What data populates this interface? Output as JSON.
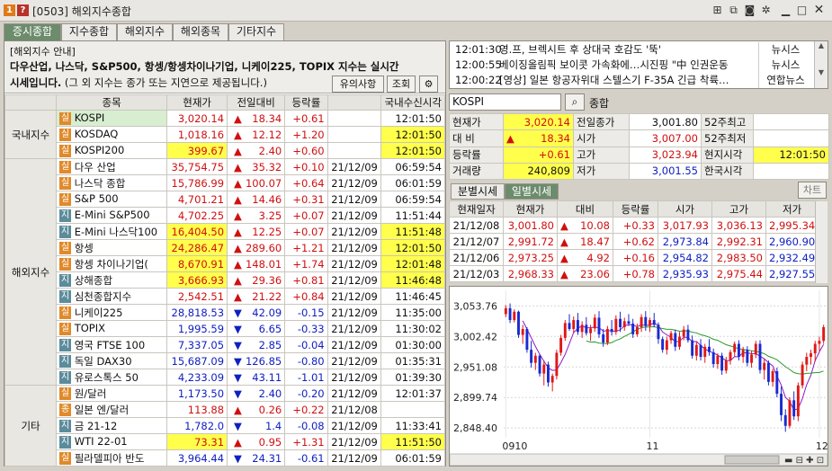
{
  "window": {
    "screen_no": "[0503]",
    "title": "해외지수종합",
    "num1": "1",
    "num2": "?"
  },
  "tabs": [
    {
      "label": "증시종합",
      "active": true
    },
    {
      "label": "지수종합",
      "active": false
    },
    {
      "label": "해외지수",
      "active": false
    },
    {
      "label": "해외종목",
      "active": false
    },
    {
      "label": "기타지수",
      "active": false
    }
  ],
  "notice": {
    "line1": "[해외지수 안내]",
    "line2": "다우산업, 나스닥, S&P500, 항셍/항셍차이나기업, 니케이225, TOPIX 지수는 실시간",
    "line3_bold": "시세입니다.",
    "line3_rest": " (그 외 지수는 종가 또는 지연으로 제공됩니다.)",
    "btn_caution": "유의사항",
    "btn_query": "조회"
  },
  "grid": {
    "headers": [
      "종목",
      "현재가",
      "전일대비",
      "등락률",
      "",
      "국내수신시각"
    ],
    "groups": [
      {
        "label": "국내지수",
        "rows": [
          {
            "badge": "실",
            "name": "KOSPI",
            "price": "3,020.14",
            "arrow": "▲",
            "chg": "18.34",
            "rate": "+0.61",
            "date": "",
            "time": "12:01:50",
            "dir": "up",
            "name_bg": "green",
            "price_bg": "",
            "time_bg": ""
          },
          {
            "badge": "실",
            "name": "KOSDAQ",
            "price": "1,018.16",
            "arrow": "▲",
            "chg": "12.12",
            "rate": "+1.20",
            "date": "",
            "time": "12:01:50",
            "dir": "up",
            "name_bg": "",
            "price_bg": "",
            "time_bg": "yellow"
          },
          {
            "badge": "실",
            "name": "KOSPI200",
            "price": "399.67",
            "arrow": "▲",
            "chg": "2.40",
            "rate": "+0.60",
            "date": "",
            "time": "12:01:50",
            "dir": "up",
            "name_bg": "",
            "price_bg": "yellow",
            "time_bg": "yellow"
          }
        ]
      },
      {
        "label": "해외지수",
        "rows": [
          {
            "badge": "실",
            "name": "다우 산업",
            "price": "35,754.75",
            "arrow": "▲",
            "chg": "35.32",
            "rate": "+0.10",
            "date": "21/12/09",
            "time": "06:59:54",
            "dir": "up",
            "name_bg": "",
            "price_bg": "",
            "time_bg": ""
          },
          {
            "badge": "실",
            "name": "나스닥 종합",
            "price": "15,786.99",
            "arrow": "▲",
            "chg": "100.07",
            "rate": "+0.64",
            "date": "21/12/09",
            "time": "06:01:59",
            "dir": "up",
            "name_bg": "",
            "price_bg": "",
            "time_bg": ""
          },
          {
            "badge": "실",
            "name": "S&P 500",
            "price": "4,701.21",
            "arrow": "▲",
            "chg": "14.46",
            "rate": "+0.31",
            "date": "21/12/09",
            "time": "06:59:54",
            "dir": "up",
            "name_bg": "",
            "price_bg": "",
            "time_bg": ""
          },
          {
            "badge": "지",
            "name": "E-Mini S&P500",
            "price": "4,702.25",
            "arrow": "▲",
            "chg": "3.25",
            "rate": "+0.07",
            "date": "21/12/09",
            "time": "11:51:44",
            "dir": "up",
            "name_bg": "",
            "price_bg": "",
            "time_bg": ""
          },
          {
            "badge": "지",
            "name": "E-Mini 나스닥100",
            "price": "16,404.50",
            "arrow": "▲",
            "chg": "12.25",
            "rate": "+0.07",
            "date": "21/12/09",
            "time": "11:51:48",
            "dir": "up",
            "name_bg": "",
            "price_bg": "yellow",
            "time_bg": "yellow"
          },
          {
            "badge": "실",
            "name": "항셍",
            "price": "24,286.47",
            "arrow": "▲",
            "chg": "289.60",
            "rate": "+1.21",
            "date": "21/12/09",
            "time": "12:01:50",
            "dir": "up",
            "name_bg": "",
            "price_bg": "yellow",
            "time_bg": "yellow"
          },
          {
            "badge": "실",
            "name": "항셍 차이나기업(",
            "price": "8,670.91",
            "arrow": "▲",
            "chg": "148.01",
            "rate": "+1.74",
            "date": "21/12/09",
            "time": "12:01:48",
            "dir": "up",
            "name_bg": "",
            "price_bg": "yellow",
            "time_bg": "yellow"
          },
          {
            "badge": "지",
            "name": "상해종합",
            "price": "3,666.93",
            "arrow": "▲",
            "chg": "29.36",
            "rate": "+0.81",
            "date": "21/12/09",
            "time": "11:46:48",
            "dir": "up",
            "name_bg": "",
            "price_bg": "yellow",
            "time_bg": "yellow"
          },
          {
            "badge": "지",
            "name": "심천종합지수",
            "price": "2,542.51",
            "arrow": "▲",
            "chg": "21.22",
            "rate": "+0.84",
            "date": "21/12/09",
            "time": "11:46:45",
            "dir": "up",
            "name_bg": "",
            "price_bg": "",
            "time_bg": ""
          },
          {
            "badge": "실",
            "name": "니케이225",
            "price": "28,818.53",
            "arrow": "▼",
            "chg": "42.09",
            "rate": "-0.15",
            "date": "21/12/09",
            "time": "11:35:00",
            "dir": "down",
            "name_bg": "",
            "price_bg": "",
            "time_bg": ""
          },
          {
            "badge": "실",
            "name": "TOPIX",
            "price": "1,995.59",
            "arrow": "▼",
            "chg": "6.65",
            "rate": "-0.33",
            "date": "21/12/09",
            "time": "11:30:02",
            "dir": "down",
            "name_bg": "",
            "price_bg": "",
            "time_bg": ""
          },
          {
            "badge": "지",
            "name": "영국 FTSE 100",
            "price": "7,337.05",
            "arrow": "▼",
            "chg": "2.85",
            "rate": "-0.04",
            "date": "21/12/09",
            "time": "01:30:00",
            "dir": "down",
            "name_bg": "",
            "price_bg": "",
            "time_bg": ""
          },
          {
            "badge": "지",
            "name": "독일 DAX30",
            "price": "15,687.09",
            "arrow": "▼",
            "chg": "126.85",
            "rate": "-0.80",
            "date": "21/12/09",
            "time": "01:35:31",
            "dir": "down",
            "name_bg": "",
            "price_bg": "",
            "time_bg": ""
          },
          {
            "badge": "지",
            "name": "유로스톡스 50",
            "price": "4,233.09",
            "arrow": "▼",
            "chg": "43.11",
            "rate": "-1.01",
            "date": "21/12/09",
            "time": "01:39:30",
            "dir": "down",
            "name_bg": "",
            "price_bg": "",
            "time_bg": ""
          }
        ]
      },
      {
        "label": "기타",
        "rows": [
          {
            "badge": "실",
            "name": "원/달러",
            "price": "1,173.50",
            "arrow": "▼",
            "chg": "2.40",
            "rate": "-0.20",
            "date": "21/12/09",
            "time": "12:01:37",
            "dir": "down",
            "name_bg": "",
            "price_bg": "",
            "time_bg": ""
          },
          {
            "badge": "종",
            "name": "일본 엔/달러",
            "price": "113.88",
            "arrow": "▲",
            "chg": "0.26",
            "rate": "+0.22",
            "date": "21/12/08",
            "time": "",
            "dir": "up",
            "name_bg": "",
            "price_bg": "",
            "time_bg": ""
          },
          {
            "badge": "지",
            "name": "금 21-12",
            "price": "1,782.0",
            "arrow": "▼",
            "chg": "1.4",
            "rate": "-0.08",
            "date": "21/12/09",
            "time": "11:33:41",
            "dir": "down",
            "name_bg": "",
            "price_bg": "",
            "time_bg": ""
          },
          {
            "badge": "지",
            "name": "WTI 22-01",
            "price": "73.31",
            "arrow": "▲",
            "chg": "0.95",
            "rate": "+1.31",
            "date": "21/12/09",
            "time": "11:51:50",
            "dir": "up",
            "name_bg": "",
            "price_bg": "yellow",
            "time_bg": "yellow"
          },
          {
            "badge": "실",
            "name": "필라델피아 반도",
            "price": "3,964.44",
            "arrow": "▼",
            "chg": "24.31",
            "rate": "-0.61",
            "date": "21/12/09",
            "time": "06:01:59",
            "dir": "down",
            "name_bg": "",
            "price_bg": "",
            "time_bg": ""
          }
        ]
      }
    ]
  },
  "news": [
    {
      "time": "12:01:30",
      "headline": "영.프, 브렉시트 후 상대국 호감도 '뚝'",
      "source": "뉴시스"
    },
    {
      "time": "12:00:55",
      "headline": "베이징올림픽 보이콧 가속화에…시진핑 \"中 인권운동",
      "source": "뉴시스"
    },
    {
      "time": "12:00:22",
      "headline": "[영상] 일본 항공자위대 스텔스기 F-35A 긴급 착륙…",
      "source": "연합뉴스"
    }
  ],
  "code": {
    "value": "KOSPI",
    "label": "종합"
  },
  "quote": [
    {
      "l1": "현재가",
      "v1": "3,020.14",
      "l2": "전일종가",
      "v2": "3,001.80",
      "l3": "52주최고",
      "v3": ""
    },
    {
      "l1": "대 비",
      "v1": "18.34",
      "l2": "시가",
      "v2": "3,007.00",
      "l3": "52주최저",
      "v3": ""
    },
    {
      "l1": "등락률",
      "v1": "+0.61",
      "l2": "고가",
      "v2": "3,023.94",
      "l3": "현지시각",
      "v3": "12:01:50"
    },
    {
      "l1": "거래량",
      "v1": "240,809",
      "l2": "저가",
      "v2": "3,001.55",
      "l3": "한국시각",
      "v3": ""
    }
  ],
  "quote_arrow": "▲",
  "subtabs": [
    {
      "label": "분별시세",
      "active": false
    },
    {
      "label": "일별시세",
      "active": true
    }
  ],
  "chart_btn": "차트",
  "daily": {
    "headers": [
      "현재일자",
      "현재가",
      "대비",
      "등락률",
      "시가",
      "고가",
      "저가"
    ],
    "rows": [
      {
        "date": "21/12/08",
        "price": "3,001.80",
        "arrow": "▲",
        "chg": "10.08",
        "rate": "+0.33",
        "open": "3,017.93",
        "high": "3,036.13",
        "low": "2,995.34",
        "c": [
          "red",
          "red",
          "red",
          "red",
          "red",
          "red"
        ]
      },
      {
        "date": "21/12/07",
        "price": "2,991.72",
        "arrow": "▲",
        "chg": "18.47",
        "rate": "+0.62",
        "open": "2,973.84",
        "high": "2,992.31",
        "low": "2,960.90",
        "c": [
          "red",
          "red",
          "red",
          "blue",
          "red",
          "blue"
        ]
      },
      {
        "date": "21/12/06",
        "price": "2,973.25",
        "arrow": "▲",
        "chg": "4.92",
        "rate": "+0.16",
        "open": "2,954.82",
        "high": "2,983.50",
        "low": "2,932.49",
        "c": [
          "red",
          "red",
          "red",
          "blue",
          "red",
          "blue"
        ]
      },
      {
        "date": "21/12/03",
        "price": "2,968.33",
        "arrow": "▲",
        "chg": "23.06",
        "rate": "+0.78",
        "open": "2,935.93",
        "high": "2,975.44",
        "low": "2,927.55",
        "c": [
          "red",
          "red",
          "red",
          "blue",
          "red",
          "blue"
        ]
      }
    ]
  },
  "chart_data": {
    "type": "candlestick",
    "y_ticks": [
      "3,053.76",
      "3,002.42",
      "2,951.08",
      "2,899.74",
      "2,848.40"
    ],
    "ylim": [
      2832,
      3080
    ],
    "x_ticks": [
      {
        "label": "0910",
        "index": 0
      },
      {
        "label": "11",
        "index": 34
      },
      {
        "label": "12",
        "index": 74
      }
    ],
    "up_color": "#e01818",
    "down_color": "#1a2ad0",
    "candles": [
      [
        3040,
        3055,
        3035,
        3050
      ],
      [
        3050,
        3058,
        3025,
        3030
      ],
      [
        3030,
        3048,
        3026,
        3044
      ],
      [
        3044,
        3046,
        3000,
        3005
      ],
      [
        3005,
        3022,
        2990,
        3015
      ],
      [
        3015,
        3018,
        2975,
        2980
      ],
      [
        2980,
        2995,
        2950,
        2958
      ],
      [
        2958,
        2975,
        2946,
        2970
      ],
      [
        2970,
        2972,
        2935,
        2940
      ],
      [
        2940,
        2962,
        2920,
        2955
      ],
      [
        2955,
        2960,
        2918,
        2925
      ],
      [
        2925,
        2940,
        2910,
        2936
      ],
      [
        2936,
        2980,
        2930,
        2975
      ],
      [
        2975,
        3005,
        2970,
        3000
      ],
      [
        3000,
        3030,
        2995,
        3025
      ],
      [
        3025,
        3040,
        3012,
        3015
      ],
      [
        3015,
        3036,
        3008,
        3030
      ],
      [
        3030,
        3042,
        3005,
        3010
      ],
      [
        3010,
        3028,
        3000,
        3022
      ],
      [
        3022,
        3035,
        3004,
        3008
      ],
      [
        3008,
        3022,
        2995,
        3016
      ],
      [
        3016,
        3040,
        3010,
        3034
      ],
      [
        3034,
        3045,
        3000,
        3006
      ],
      [
        3006,
        3015,
        2985,
        2992
      ],
      [
        2992,
        3020,
        2988,
        3015
      ],
      [
        3015,
        3030,
        3004,
        3010
      ],
      [
        3010,
        3038,
        3005,
        3032
      ],
      [
        3032,
        3044,
        3010,
        3018
      ],
      [
        3018,
        3034,
        3012,
        3028
      ],
      [
        3028,
        3040,
        3020,
        3024
      ],
      [
        3024,
        3032,
        3000,
        3006
      ],
      [
        3006,
        3024,
        3002,
        3018
      ],
      [
        3018,
        3040,
        3010,
        3035
      ],
      [
        3035,
        3045,
        3012,
        3020
      ],
      [
        3020,
        3034,
        3010,
        3030
      ],
      [
        3030,
        3042,
        3018,
        3022
      ],
      [
        3022,
        3026,
        2990,
        2998
      ],
      [
        2998,
        3002,
        2975,
        2980
      ],
      [
        2980,
        3002,
        2972,
        2996
      ],
      [
        2996,
        3012,
        2990,
        3008
      ],
      [
        3008,
        3014,
        2978,
        2985
      ],
      [
        2985,
        3010,
        2980,
        3002
      ],
      [
        3002,
        3020,
        2996,
        3014
      ],
      [
        3014,
        3022,
        2992,
        2996
      ],
      [
        2996,
        3004,
        2965,
        2970
      ],
      [
        2970,
        2994,
        2962,
        2988
      ],
      [
        2988,
        2998,
        2962,
        2968
      ],
      [
        2968,
        2990,
        2958,
        2985
      ],
      [
        2985,
        2998,
        2970,
        2976
      ],
      [
        2976,
        2982,
        2950,
        2956
      ],
      [
        2956,
        2974,
        2948,
        2970
      ],
      [
        2970,
        2975,
        2938,
        2945
      ],
      [
        2945,
        2968,
        2940,
        2962
      ],
      [
        2962,
        2980,
        2955,
        2976
      ],
      [
        2976,
        2994,
        2968,
        2990
      ],
      [
        2990,
        2996,
        2962,
        2968
      ],
      [
        2968,
        2985,
        2958,
        2980
      ],
      [
        2980,
        2986,
        2952,
        2958
      ],
      [
        2958,
        2978,
        2950,
        2972
      ],
      [
        2972,
        2995,
        2966,
        2990
      ],
      [
        2990,
        2996,
        2940,
        2946
      ],
      [
        2946,
        2964,
        2930,
        2958
      ],
      [
        2958,
        2962,
        2920,
        2926
      ],
      [
        2926,
        2948,
        2918,
        2944
      ],
      [
        2944,
        2950,
        2900,
        2906
      ],
      [
        2906,
        2918,
        2860,
        2870
      ],
      [
        2870,
        2880,
        2842,
        2852
      ],
      [
        2852,
        2900,
        2848,
        2895
      ],
      [
        2895,
        2910,
        2862,
        2868
      ],
      [
        2868,
        2925,
        2860,
        2920
      ],
      [
        2920,
        2960,
        2915,
        2955
      ],
      [
        2955,
        2975,
        2944,
        2968
      ],
      [
        2968,
        2980,
        2955,
        2974
      ],
      [
        2974,
        2995,
        2960,
        2990
      ],
      [
        2990,
        3002,
        2978,
        2995
      ],
      [
        2995,
        3022,
        2990,
        3018
      ]
    ],
    "ma1_color": "#8a1ac8",
    "ma2_color": "#2a9a2a"
  }
}
